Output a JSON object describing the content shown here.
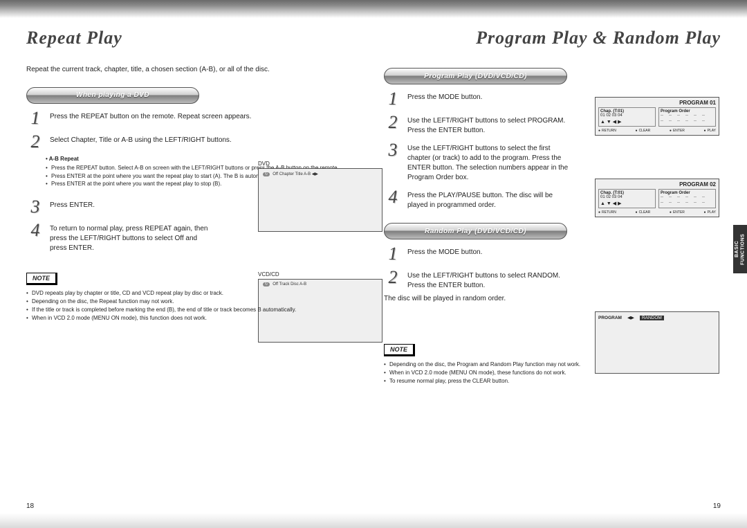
{
  "page_numbers": {
    "left": "18",
    "right": "19"
  },
  "side_tab": "BASIC FUNCTIONS",
  "left": {
    "title": "Repeat Play",
    "intro": "Repeat the current track, chapter, title, a chosen section (A-B), or all of the disc.",
    "pill": "When playing a DVD",
    "steps": {
      "s1": "Press the REPEAT button on the remote. Repeat screen appears.",
      "s2": "Select Chapter, Title or A-B using the LEFT/RIGHT buttons.",
      "s3": "Press ENTER.",
      "s4": "To return to normal play, press REPEAT again, then press the LEFT/RIGHT buttons to select Off and press ENTER."
    },
    "sub": {
      "head": "• A-B Repeat",
      "b1": "Press the REPEAT button. Select A-B on screen with the LEFT/RIGHT buttons or press the A-B button on the remote.",
      "b2": "Press ENTER at the point where you want the repeat play to start (A). The B is automatically highlighted.",
      "b3": "Press ENTER at the point where you want the repeat play to stop (B)."
    },
    "osd": {
      "dvd_label": "DVD",
      "dvd_line": "Off   Chapter   Title   A-B   ◀▶",
      "vcd_label": "VCD/CD",
      "vcd_line": "Off   Track   Disc   A-B"
    },
    "note_label": "NOTE",
    "notes": {
      "n1": "DVD repeats play by chapter or title, CD and VCD repeat play by disc or track.",
      "n2": "Depending on the disc, the Repeat function may not work.",
      "n3": "If the title or track is completed before marking the end (B), the end of title or track becomes B automatically.",
      "n4": "When in VCD 2.0 mode (MENU ON mode), this function does not work."
    }
  },
  "right": {
    "title": "Program Play & Random Play",
    "pill_program": "Program Play (DVD/VCD/CD)",
    "program_steps": {
      "s1": "Press the MODE button.",
      "s2": "Use the LEFT/RIGHT buttons to select PROGRAM. Press the ENTER button.",
      "s3": "Use the LEFT/RIGHT buttons to select the first chapter (or track) to add to the program. Press the ENTER button. The selection numbers appear in the Program Order box.",
      "s4": "Press the PLAY/PAUSE button. The disc will be played in programmed order."
    },
    "pill_random": "Random Play (DVD/VCD/CD)",
    "random_steps": {
      "s1": "Press the MODE button.",
      "s2": "Use the LEFT/RIGHT buttons to select RANDOM. Press the ENTER button."
    },
    "random_after": "The disc will be played in random order.",
    "note_label": "NOTE",
    "notes": {
      "n1": "Depending on the disc, the Program and Random Play function may not work.",
      "n2": "When in VCD 2.0 mode (MENU ON mode), these functions do not work.",
      "n3": "To resume normal play, press the CLEAR button."
    },
    "osd": {
      "prog1_hdr": "PROGRAM 01",
      "prog2_hdr": "PROGRAM 02",
      "chap_lbl": "Chap. (T:01)",
      "order_lbl": "Program Order",
      "chaps": "01  02  03  04",
      "ftr_return": "RETURN",
      "ftr_clear": "CLEAR",
      "ftr_enter": "ENTER",
      "ftr_play": "PLAY",
      "rand_program": "PROGRAM",
      "rand_arrows": "◀▶",
      "rand_random": "RANDOM"
    }
  }
}
